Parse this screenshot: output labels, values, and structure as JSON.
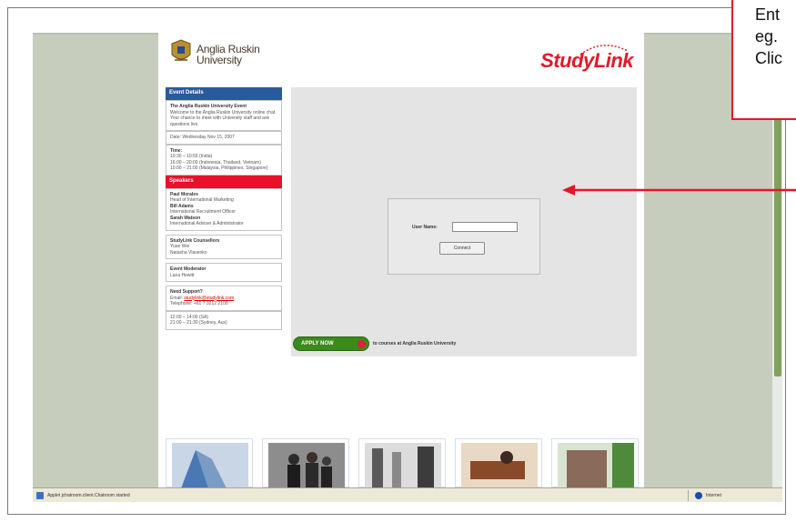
{
  "university": {
    "logo_text_line1": "Anglia Ruskin",
    "logo_text_line2": "University"
  },
  "brand": {
    "studylink": "StudyLink",
    "accent": "#e01a2a"
  },
  "sidebar": {
    "event_details_header": "Event Details",
    "event_title": "The Anglia Ruskin University Event",
    "event_desc": "Welcome to the Anglia Ruskin University online chat. Your chance to meet with University staff and ask questions live.",
    "date_line": "Date: Wednesday Nov 15, 2007",
    "time_label": "Time:",
    "time_lines": [
      "10:30 – 10:55 (India)",
      "16:00 – 20:00 (Indonesia, Thailand, Vietnam)",
      "10:00 – 21:00 (Malaysia, Philippines, Singapore)"
    ],
    "speakers_header": "Speakers",
    "speakers": [
      {
        "name": "Paul Morales",
        "role": "Head of International Marketing"
      },
      {
        "name": "Bill Adams",
        "role": "International Recruitment Officer"
      },
      {
        "name": "Sarah Watson",
        "role": "International Adviser & Administrator"
      }
    ],
    "studylink_counsellors_title": "StudyLink Counsellors",
    "studylink_counsellors": [
      "Yuan Wei",
      "Natasha Vlasenko"
    ],
    "event_moderator_title": "Event Moderator",
    "event_moderator": "Lana Hewitt",
    "support_title": "Need Support?",
    "support_email_label": "Email:",
    "support_email": "studylink@studylink.com",
    "support_phone": "Telephone: +61 7 3212 2100",
    "support_hours": [
      "12:00 – 14:00 (SA)",
      "21:00 – 21:30 (Sydney, Aus)"
    ]
  },
  "login": {
    "username_label": "User Name:",
    "username_value": "",
    "connect_label": "Connect"
  },
  "apply": {
    "button_label": "APPLY NOW",
    "caption": "to courses at Anglia Ruskin University"
  },
  "thumbnails": [
    "campus-building",
    "students-group",
    "corridor",
    "lab-workshop",
    "brick-building"
  ],
  "statusbar": {
    "left_text": "Applet jchatroom.client.Chatroom started",
    "zone_text": "Internet"
  },
  "callout": {
    "lines": [
      "Ent",
      "eg.",
      "Clic"
    ],
    "border_color": "#e5142b"
  }
}
